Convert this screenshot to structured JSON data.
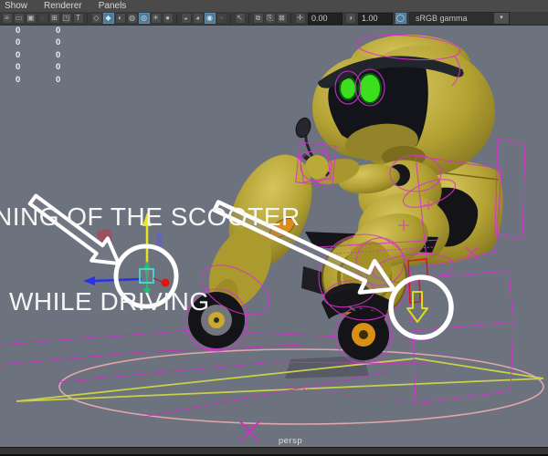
{
  "menubar": {
    "items": [
      {
        "label": "Show"
      },
      {
        "label": "Renderer"
      },
      {
        "label": "Panels"
      }
    ]
  },
  "toolbar": {
    "icons": [
      {
        "name": "panel-menu-icon",
        "glyph": "≡"
      },
      {
        "name": "single-pane-icon",
        "glyph": "▭"
      },
      {
        "name": "pane-dot-icon",
        "glyph": "▣"
      },
      {
        "name": "pane-dim-icon",
        "glyph": "▫"
      },
      {
        "name": "four-pane-icon",
        "glyph": "⊞"
      },
      {
        "name": "pane-corner-icon",
        "glyph": "◳"
      },
      {
        "name": "pane-text-icon",
        "glyph": "T"
      },
      {
        "name": "wireframe-cube-icon",
        "glyph": "◇"
      },
      {
        "name": "smooth-shade-icon",
        "glyph": "◆"
      },
      {
        "name": "half-sphere-icon",
        "glyph": "◐"
      },
      {
        "name": "textured-sphere-icon",
        "glyph": "◍"
      },
      {
        "name": "textured-lit-icon",
        "glyph": "◎"
      },
      {
        "name": "lights-icon",
        "glyph": "☀"
      },
      {
        "name": "shaded-sphere-icon",
        "glyph": "●"
      },
      {
        "name": "camera-sphere-icon",
        "glyph": "◒"
      },
      {
        "name": "lit-sphere-icon",
        "glyph": "◕"
      },
      {
        "name": "default-material-icon",
        "glyph": "◉"
      },
      {
        "name": "dim-pane2-icon",
        "glyph": "▪"
      },
      {
        "name": "isolate-select-icon",
        "glyph": "↖"
      },
      {
        "name": "field-chart-icon",
        "glyph": "⧉"
      },
      {
        "name": "book-pair-icon",
        "glyph": "⎘"
      },
      {
        "name": "grease-pencil-icon",
        "glyph": "⊠"
      }
    ],
    "exposure": {
      "glyph": "✛",
      "value": "0.00"
    },
    "contrast": {
      "glyph": "◑",
      "value": "1.00"
    },
    "gamma_toggle": {
      "glyph": "◯"
    },
    "view_transform": {
      "label": "sRGB gamma",
      "arrow": "▾"
    }
  },
  "channel_values": {
    "rows": [
      [
        "0",
        "0"
      ],
      [
        "0",
        "0"
      ],
      [
        "0",
        "0"
      ],
      [
        "0",
        "0"
      ],
      [
        "0",
        "0"
      ]
    ]
  },
  "annotation": {
    "line1": "NING OF THE SCOOTER",
    "line2": "WHILE DRIVING"
  },
  "viewport": {
    "camera_label": "persp"
  },
  "colors": {
    "viewport_bg": "#6c727e",
    "menubar_bg": "#4a4a4a",
    "toolbar_bg": "#3b3b3b",
    "active_icon_bg": "#4f7a99",
    "robot_yellow": "#b2a132",
    "selection_magenta": "#d932cf",
    "red_wireframe": "#e01414",
    "eye_green": "#3bdf1d",
    "annotation_white": "#f5f5f5",
    "manipulator_axis_yellow": "#e8e61a",
    "manipulator_axis_blue": "#2633e8",
    "manipulator_axis_green": "#28b877",
    "manipulator_center_cyan": "#4fd8d0",
    "motion_path_yellow": "#c9d148",
    "ground_curve_pink": "#e2a7ad",
    "decal_orange": "#df8b1a"
  }
}
